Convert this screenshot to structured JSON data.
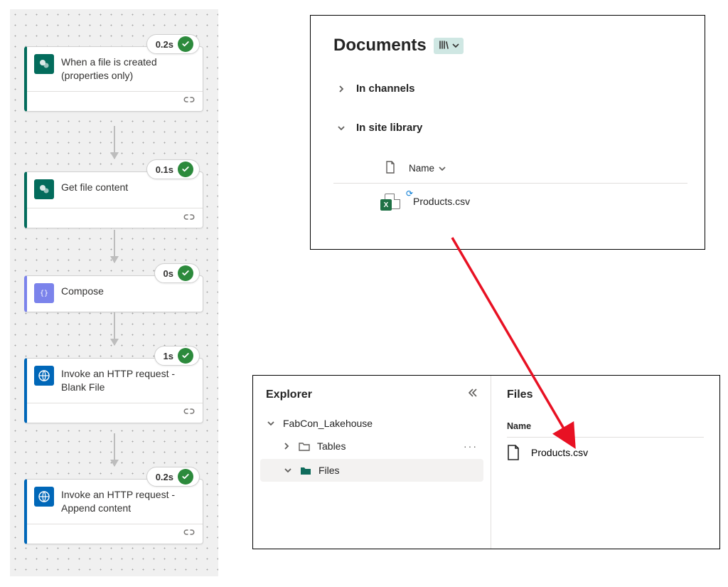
{
  "flow": {
    "steps": [
      {
        "title": "When a file is created (properties only)",
        "time": "0.2s",
        "kind": "sp",
        "accent": "teal"
      },
      {
        "title": "Get file content",
        "time": "0.1s",
        "kind": "sp",
        "accent": "teal"
      },
      {
        "title": "Compose",
        "time": "0s",
        "kind": "cp",
        "accent": "purple"
      },
      {
        "title": "Invoke an HTTP request - Blank File",
        "time": "1s",
        "kind": "ht",
        "accent": "blue"
      },
      {
        "title": "Invoke an HTTP request - Append content",
        "time": "0.2s",
        "kind": "ht",
        "accent": "blue"
      }
    ]
  },
  "documents": {
    "title": "Documents",
    "sections": {
      "channels_label": "In channels",
      "library_label": "In site library"
    },
    "column_header": "Name",
    "file_name": "Products.csv"
  },
  "explorer": {
    "title": "Explorer",
    "root": "FabCon_Lakehouse",
    "folders": {
      "tables": "Tables",
      "files": "Files"
    },
    "right": {
      "title": "Files",
      "name_label": "Name",
      "file_name": "Products.csv"
    }
  }
}
